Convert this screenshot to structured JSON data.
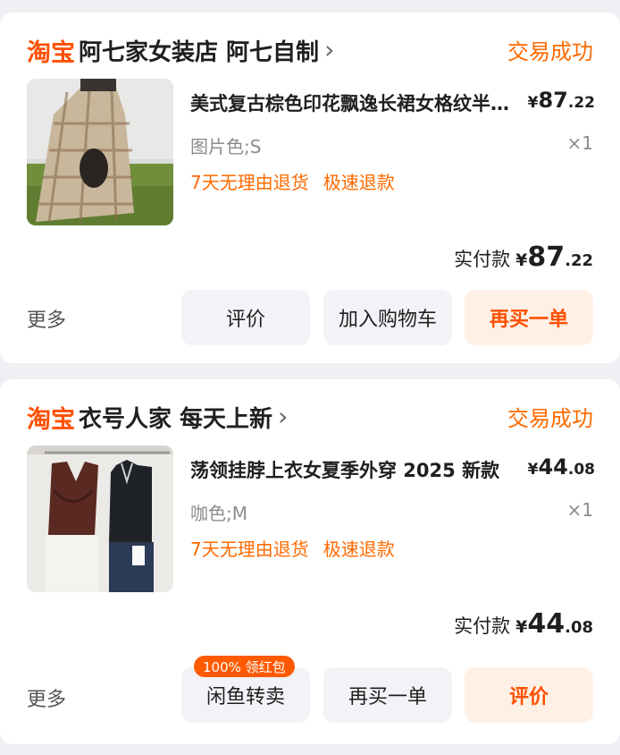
{
  "orders": [
    {
      "platform": "淘宝",
      "shop_name": "阿七家女装店 阿七自制",
      "status": "交易成功",
      "item_title": "美式复古棕色印花飘逸长裙女格纹半身裙",
      "price_symbol": "¥",
      "price_int": "87",
      "price_dec": ".22",
      "spec": "图片色;S",
      "quantity": "×1",
      "tags": [
        "7天无理由退货",
        "极速退款"
      ],
      "paid_label": "实付款",
      "paid_symbol": "¥",
      "paid_int": "87",
      "paid_dec": ".22",
      "more_label": "更多",
      "buttons": [
        "评价",
        "加入购物车",
        "再买一单"
      ]
    },
    {
      "platform": "淘宝",
      "shop_name": "衣号人家 每天上新",
      "status": "交易成功",
      "item_title": "荡领挂脖上衣女夏季外穿 2025 新款",
      "price_symbol": "¥",
      "price_int": "44",
      "price_dec": ".08",
      "spec": "咖色;M",
      "quantity": "×1",
      "tags": [
        "7天无理由退货",
        "极速退款"
      ],
      "paid_label": "实付款",
      "paid_symbol": "¥",
      "paid_int": "44",
      "paid_dec": ".08",
      "more_label": "更多",
      "badge": "100% 领红包",
      "buttons": [
        "闲鱼转卖",
        "再买一单",
        "评价"
      ]
    }
  ],
  "colors": {
    "brand_orange": "#ff5000",
    "status_orange": "#ff6a00",
    "secondary_button_bg": "#f1f3f7",
    "primary_button_bg": "#fff0e5"
  }
}
